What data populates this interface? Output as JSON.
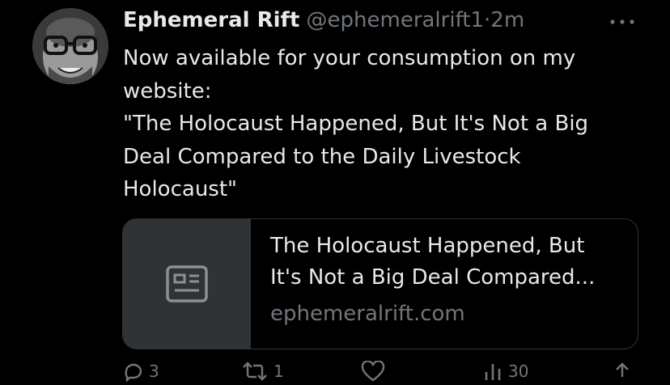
{
  "tweet": {
    "display_name": "Ephemeral Rift",
    "handle": "@ephemeralrift1",
    "separator": "·",
    "timestamp": "2m",
    "more_icon": "more-horizontal-icon",
    "text_lines": [
      "Now available for your consumption on my",
      "website:",
      "\"The Holocaust Happened, But It's Not a Big",
      "Deal Compared to the Daily Livestock",
      "Holocaust\""
    ]
  },
  "link_card": {
    "thumbnail_icon": "article-icon",
    "title_lines": [
      "The Holocaust Happened, But",
      "It's Not a Big Deal Compared..."
    ],
    "domain": "ephemeralrift.com"
  },
  "actions": {
    "reply_count": "3",
    "retweet_count": "1",
    "like_count": "",
    "views_count": "30",
    "reply_icon": "reply-icon",
    "retweet_icon": "retweet-icon",
    "like_icon": "heart-icon",
    "views_icon": "views-icon",
    "share_icon": "share-icon"
  },
  "colors": {
    "background": "#000000",
    "primary_text": "#e7e9ea",
    "secondary_text": "#71767b",
    "card_border": "#2f3336"
  }
}
